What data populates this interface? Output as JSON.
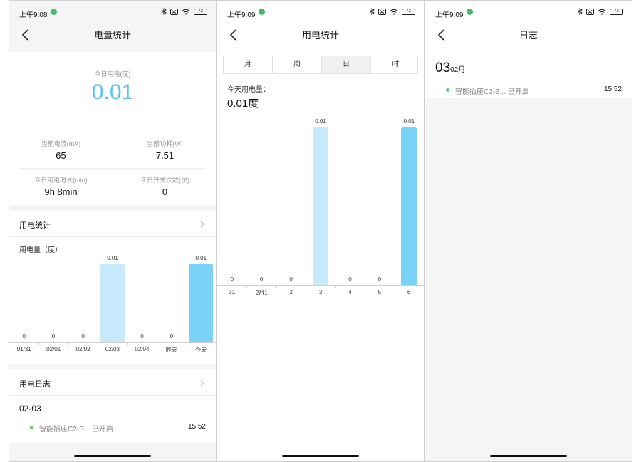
{
  "colors": {
    "accent": "#57c3ee",
    "bar_light": "#c6eafb",
    "bar_dark": "#7bd2f7",
    "status_dot": "#5bc86a"
  },
  "status": [
    {
      "time": "上午9:08",
      "battery": "72"
    },
    {
      "time": "上午9:09",
      "battery": "72"
    },
    {
      "time": "上午9:09",
      "battery": "72"
    }
  ],
  "screen1": {
    "title": "电量统计",
    "today_label": "今日用电(度)",
    "today_value": "0.01",
    "stats": [
      {
        "label": "当前电流(mA)",
        "value": "65"
      },
      {
        "label": "当前功耗(W)",
        "value": "7.51"
      },
      {
        "label": "今日用电时长(min)",
        "value": "9h 8min"
      },
      {
        "label": "今日开关次数(次)",
        "value": "0"
      }
    ],
    "usage_section": "用电统计",
    "chart_title": "用电量（度）",
    "log_section": "用电日志",
    "log_date": "02-03",
    "log_entry": {
      "device": "智能插座C2-B...",
      "action": "已开启",
      "time": "15:52"
    }
  },
  "screen2": {
    "title": "用电统计",
    "tabs": [
      "月",
      "周",
      "日",
      "时"
    ],
    "selected_tab": "日",
    "today_label": "今天用电量：",
    "today_value": "0.01度"
  },
  "screen3": {
    "title": "日志",
    "date_day": "03",
    "date_month": "02月",
    "log_entry": {
      "device": "智能插座C2-B...",
      "action": "已开启",
      "time": "15:52"
    }
  },
  "chart_data": [
    {
      "type": "bar",
      "title": "用电量（度）",
      "categories": [
        "01/31",
        "02/01",
        "02/02",
        "02/03",
        "02/04",
        "昨天",
        "今天"
      ],
      "values": [
        0,
        0,
        0,
        0.01,
        0,
        0,
        0.01
      ],
      "value_labels": [
        "0",
        "0",
        "0",
        "0.01",
        "0",
        "0",
        "0.01"
      ],
      "highlight_index": 6,
      "ylim": [
        0,
        0.01
      ]
    },
    {
      "type": "bar",
      "categories": [
        "31",
        "2月1",
        "2",
        "3",
        "4",
        "5",
        "6"
      ],
      "values": [
        0,
        0,
        0,
        0.01,
        0,
        0,
        0.01
      ],
      "value_labels": [
        "0",
        "0",
        "0",
        "0.01",
        "0",
        "0",
        "0.01"
      ],
      "highlight_index": 6,
      "ylim": [
        0,
        0.01
      ]
    }
  ]
}
